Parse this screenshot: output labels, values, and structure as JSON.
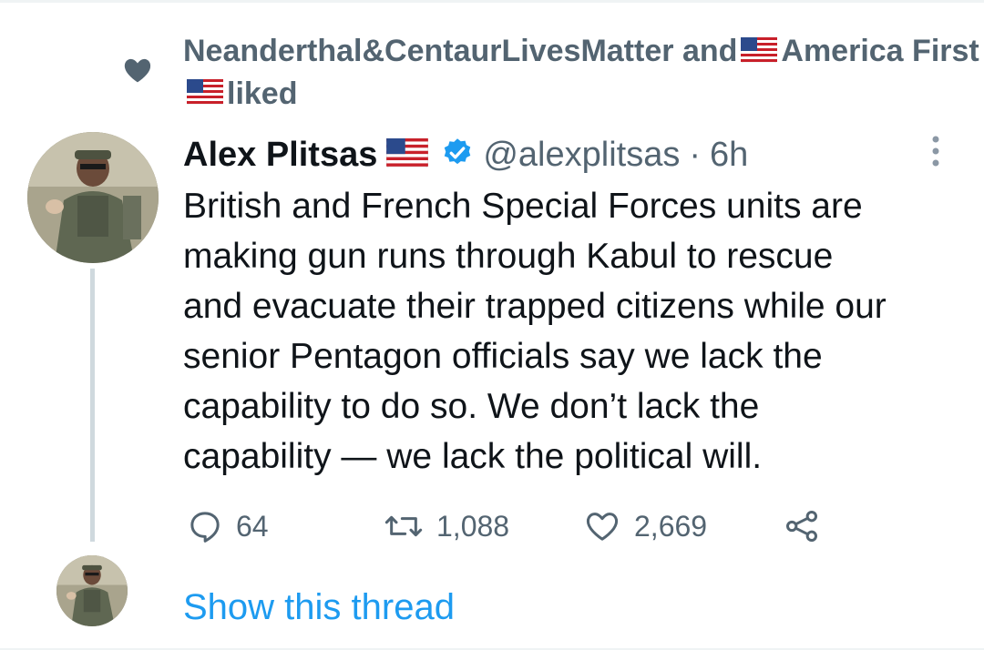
{
  "social_context": {
    "icon": "heart-filled-icon",
    "user1": "Neanderthal&CentaurLivesMatter",
    "joiner": "and",
    "user2_part1": "America",
    "user2_part2": "First",
    "action": "liked"
  },
  "tweet": {
    "author_name": "Alex Plitsas",
    "handle": "@alexplitsas",
    "separator": "·",
    "time": "6h",
    "text": "British and French Special Forces units are\nmaking gun runs through Kabul to rescue\nand evacuate their trapped citizens while our\nsenior Pentagon officials say we lack the\ncapability to do so. We don’t lack the\ncapability — we lack the political will."
  },
  "actions": {
    "replies": "64",
    "retweets": "1,088",
    "likes": "2,669"
  },
  "show_thread": "Show this thread",
  "colors": {
    "link_blue": "#1d9bf0",
    "secondary_text": "#536471",
    "primary_text": "#0f1419",
    "thread_line": "#cfd9de"
  }
}
